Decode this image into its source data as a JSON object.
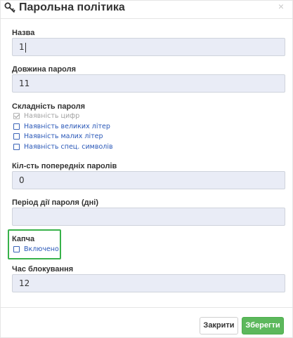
{
  "dialog": {
    "title": "Парольна політика",
    "close_glyph": "×",
    "icon": "key-icon"
  },
  "fields": {
    "name": {
      "label": "Назва",
      "value": "1"
    },
    "length": {
      "label": "Довжина пароля",
      "value": "11"
    },
    "complexity": {
      "label": "Складність пароля",
      "options": [
        {
          "label": "Наявність цифр",
          "checked": true,
          "disabled": true
        },
        {
          "label": "Наявність великих літер",
          "checked": false,
          "disabled": false
        },
        {
          "label": "Наявність малих літер",
          "checked": false,
          "disabled": false
        },
        {
          "label": "Наявність спец. символів",
          "checked": false,
          "disabled": false
        }
      ]
    },
    "previous": {
      "label": "Кіл-сть попередніх паролів",
      "value": "0"
    },
    "period": {
      "label": "Період дії пароля (дні)",
      "value": ""
    },
    "captcha": {
      "label": "Капча",
      "option_label": "Включено",
      "checked": false
    },
    "lock_time": {
      "label": "Час блокування",
      "value": "12"
    }
  },
  "footer": {
    "close_label": "Закрити",
    "save_label": "Зберегти"
  },
  "colors": {
    "highlight": "#38b24a",
    "save_button": "#5cb85c",
    "link": "#2a58b8",
    "input_bg": "#e9ecf6"
  }
}
